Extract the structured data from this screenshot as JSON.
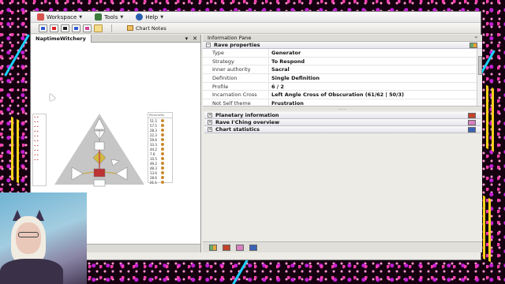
{
  "menubar": {
    "items": [
      {
        "label": "Workspace",
        "icon": "workspace-icon",
        "color": "#d9534f"
      },
      {
        "label": "Tools",
        "icon": "tools-icon",
        "color": "#3d7a3d"
      },
      {
        "label": "Help",
        "icon": "help-icon",
        "color": "#2a5db0"
      }
    ]
  },
  "toolbar": {
    "buttons": [
      "new-chart-icon",
      "color-red-icon",
      "color-black-icon",
      "color-blue-icon",
      "color-pink-icon",
      "note-icon"
    ],
    "chart_notes_label": "Chart Notes"
  },
  "document": {
    "tab_label": "NaptimeWitchery",
    "pin_symbol": "▾",
    "close_symbol": "✕"
  },
  "bodygraph": {
    "right_column_header": "Personality",
    "personality": [
      {
        "value": "51.5"
      },
      {
        "value": "57.5"
      },
      {
        "value": "28.3"
      },
      {
        "value": "22.3"
      },
      {
        "value": "59.6"
      },
      {
        "value": "33.3"
      },
      {
        "value": "44.2"
      },
      {
        "value": "7.6"
      },
      {
        "value": "10.5"
      },
      {
        "value": "49.2"
      },
      {
        "value": "48.3"
      },
      {
        "value": "13.6"
      },
      {
        "value": "28.6"
      },
      {
        "value": "21.1"
      }
    ]
  },
  "info_pane": {
    "title": "Information Pane",
    "pin_symbol": "ᵖ",
    "rave_properties": {
      "header": "Rave properties",
      "rows": [
        {
          "key": "Type",
          "value": "Generator"
        },
        {
          "key": "Strategy",
          "value": "To Respond"
        },
        {
          "key": "Inner authority",
          "value": "Sacral"
        },
        {
          "key": "Definition",
          "value": "Single Definition"
        },
        {
          "key": "Profile",
          "value": "6 / 2"
        },
        {
          "key": "Incarnation Cross",
          "value": "Left Angle Cross of Obscuration (61/62 | 50/3)"
        },
        {
          "key": "Not Self theme",
          "value": "Frustration"
        }
      ]
    },
    "sections": [
      {
        "label": "Planetary information",
        "icon": "planetary-icon"
      },
      {
        "label": "Rave I'Ching overview",
        "icon": "iching-icon"
      },
      {
        "label": "Chart statistics",
        "icon": "statistics-icon"
      }
    ],
    "splitter": "......",
    "expand_symbol": "+",
    "collapse_symbol": "−"
  },
  "colors": {
    "accent_pink": "#ff3fb0",
    "pane_bg": "#ecebe6",
    "gate_defined": "#d3b840"
  }
}
